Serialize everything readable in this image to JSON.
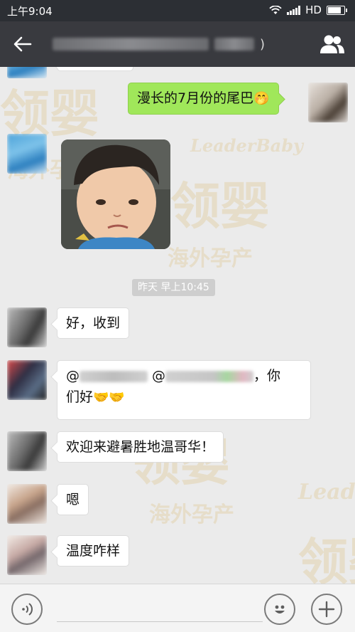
{
  "status_bar": {
    "time": "上午9:04",
    "network": "HD",
    "battery_level": 0.85
  },
  "nav": {
    "back_icon": "back-arrow-icon",
    "title_suffix": ")",
    "group_icon": "group-members-icon"
  },
  "messages": [
    {
      "sender": "self",
      "text": "漫长的7月份的尾巴",
      "emoji": "🤭"
    },
    {
      "sender": "other",
      "type": "image"
    },
    {
      "type": "time",
      "text": "昨天 早上10:45"
    },
    {
      "sender": "other",
      "text": "好，收到"
    },
    {
      "sender": "other",
      "mention_prefix": "@",
      "mention_prefix2": "@",
      "text_after": "，你",
      "text_line2": "们好",
      "emoji": "🤝🤝"
    },
    {
      "sender": "other",
      "text": "欢迎来避暑胜地温哥华！"
    },
    {
      "sender": "other",
      "text": "嗯"
    },
    {
      "sender": "other",
      "text": "温度咋样"
    }
  ],
  "watermark": {
    "brand_cn": "领婴",
    "brand_en": "LeaderBaby",
    "tagline": "海外孕产"
  },
  "input_bar": {
    "voice_icon": "voice-input-icon",
    "emoji_icon": "emoji-smile-icon",
    "more_icon": "plus-icon"
  },
  "colors": {
    "nav_bg": "#393a3f",
    "status_bg": "#2c2f34",
    "self_bubble": "#a0e75a",
    "chat_bg": "#ebebeb"
  }
}
